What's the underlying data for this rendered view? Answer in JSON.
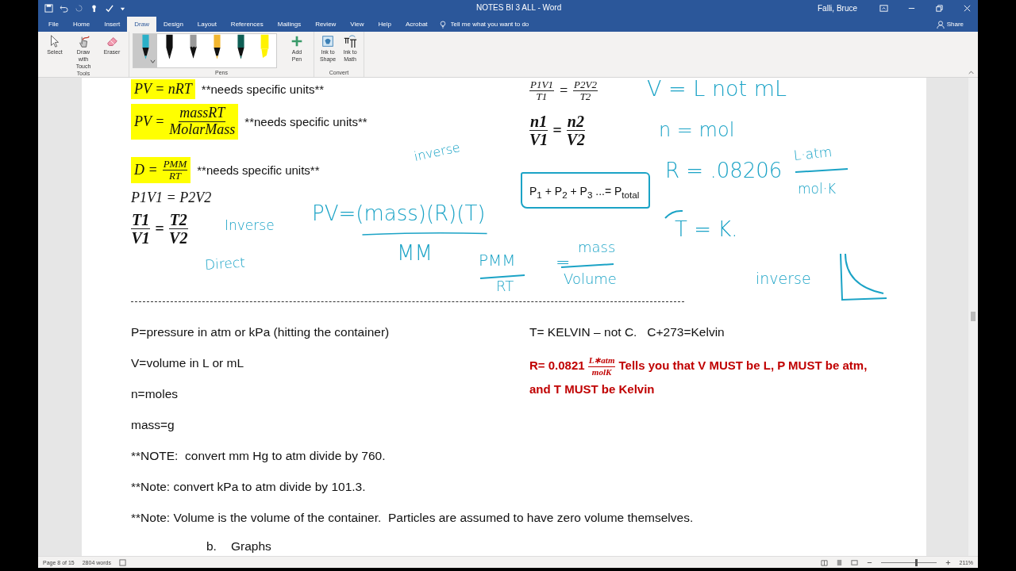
{
  "title_bar": {
    "document_title": "NOTES BI 3 ALL  -  Word",
    "user": "Falli, Bruce"
  },
  "ribbon_tabs": [
    {
      "label": "File",
      "selected": false
    },
    {
      "label": "Home",
      "selected": false
    },
    {
      "label": "Insert",
      "selected": false
    },
    {
      "label": "Draw",
      "selected": true
    },
    {
      "label": "Design",
      "selected": false
    },
    {
      "label": "Layout",
      "selected": false
    },
    {
      "label": "References",
      "selected": false
    },
    {
      "label": "Mailings",
      "selected": false
    },
    {
      "label": "Review",
      "selected": false
    },
    {
      "label": "View",
      "selected": false
    },
    {
      "label": "Help",
      "selected": false
    },
    {
      "label": "Acrobat",
      "selected": false
    }
  ],
  "tell_me": {
    "placeholder": "Tell me what you want to do"
  },
  "share": "Share",
  "ribbon": {
    "tools": {
      "label": "Tools",
      "buttons": [
        {
          "kind": "select",
          "label": "Select"
        },
        {
          "kind": "touch",
          "label": "Draw with Touch"
        },
        {
          "kind": "eraser",
          "label": "Eraser"
        }
      ]
    },
    "pens": {
      "label": "Pens",
      "items": [
        {
          "kind": "pen",
          "color": "#2bb0c8",
          "selected": true
        },
        {
          "kind": "pen",
          "color": "#111111",
          "selected": false
        },
        {
          "kind": "pencil",
          "color": "#9a9a9a",
          "selected": false
        },
        {
          "kind": "pen",
          "color": "#f2b630",
          "selected": false
        },
        {
          "kind": "pen",
          "color": "#0f5f55",
          "selected": false
        },
        {
          "kind": "highlighter",
          "color": "#fff200",
          "selected": false
        }
      ],
      "add_pen": "Add Pen"
    },
    "convert": {
      "label": "Convert",
      "buttons": [
        {
          "kind": "shape",
          "label": "Ink to Shape"
        },
        {
          "kind": "math",
          "label": "Ink to Math"
        }
      ]
    }
  },
  "document": {
    "left_formulas": [
      {
        "kind": "inline",
        "lhs": "PV =",
        "rhs": "nRT",
        "highlighted": true,
        "note": "**needs specific units**"
      },
      {
        "kind": "fraction",
        "lhs": "PV =",
        "numerator": "massRT",
        "denominator": "MolarMass",
        "highlighted": true,
        "note": "**needs specific units**"
      },
      {
        "kind": "fraction",
        "lhs": "D =",
        "numerator": "PMM",
        "denominator": "RT",
        "highlighted": true,
        "note": "**needs specific units**"
      },
      {
        "kind": "inline",
        "lhs": "P1V1 =",
        "rhs": "P2V2",
        "highlighted": false
      },
      {
        "kind": "ratio",
        "left_numerator": "T1",
        "left_denominator": "V1",
        "relation": "=",
        "right_numerator": "T2",
        "right_denominator": "V2"
      }
    ],
    "right_formulas": [
      {
        "kind": "ratio",
        "left_numerator": "P1V1",
        "left_denominator": "T1",
        "relation": "=",
        "right_numerator": "P2V2",
        "right_denominator": "T2",
        "bold": false
      },
      {
        "kind": "ratio",
        "left_numerator": "n1",
        "left_denominator": "V1",
        "relation": "=",
        "right_numerator": "n2",
        "right_denominator": "V2",
        "bold": true
      },
      {
        "kind": "sum",
        "text": "P$_{1}$ + P$_{2}$ +  P$_{3}$ ...= P$_{total}$"
      }
    ],
    "ink": [
      "inverse",
      "PV=(mass)(R)(T)",
      "MM",
      "Inverse",
      "Direct",
      "PMM",
      "RT",
      "=",
      "mass",
      "Volume",
      "V = L not mL",
      "n = mol",
      "R = .08206",
      "L·atm",
      "mol·K",
      "T = K.",
      "inverse"
    ],
    "definitions": [
      "P=pressure in atm or kPa (hitting the container)",
      "V=volume in L or mL",
      "n=moles",
      "mass=g",
      "**NOTE:  convert mm Hg to atm divide by 760.",
      "**Note: convert kPa to atm divide by 101.3.",
      "**Note: Volume is the volume of the container.  Particles are assumed to have zero volume themselves."
    ],
    "kelvin_note": "T= KELVIN – not C.   C+273=Kelvin",
    "gas_constant": {
      "prefix": "R= 0.0821",
      "numerator": "L∗atm",
      "denominator": "molK",
      "text": "Tells you that V MUST be L, P MUST be atm, and T MUST be Kelvin"
    },
    "heading": {
      "number": "b.",
      "text": "Graphs"
    }
  },
  "status_bar": {
    "page": "Page 8 of 15",
    "words": "2804 words",
    "zoom": "211%",
    "zoom_slider": {
      "level": 0.62
    }
  }
}
